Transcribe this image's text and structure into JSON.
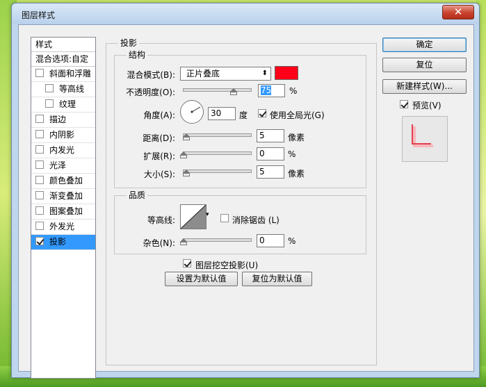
{
  "window": {
    "title": "图层样式",
    "close": "✕"
  },
  "style_list": {
    "header": "样式",
    "blend_options": "混合选项:自定",
    "items": [
      {
        "label": "斜面和浮雕",
        "checked": false,
        "sub": false
      },
      {
        "label": "等高线",
        "checked": false,
        "sub": true
      },
      {
        "label": "纹理",
        "checked": false,
        "sub": true
      },
      {
        "label": "描边",
        "checked": false,
        "sub": false
      },
      {
        "label": "内阴影",
        "checked": false,
        "sub": false
      },
      {
        "label": "内发光",
        "checked": false,
        "sub": false
      },
      {
        "label": "光泽",
        "checked": false,
        "sub": false
      },
      {
        "label": "颜色叠加",
        "checked": false,
        "sub": false
      },
      {
        "label": "渐变叠加",
        "checked": false,
        "sub": false
      },
      {
        "label": "图案叠加",
        "checked": false,
        "sub": false
      },
      {
        "label": "外发光",
        "checked": false,
        "sub": false
      },
      {
        "label": "投影",
        "checked": true,
        "sub": false,
        "selected": true
      }
    ]
  },
  "drop_shadow": {
    "section_title": "投影",
    "structure": {
      "title": "结构",
      "blend_mode_label": "混合模式(B):",
      "blend_mode_value": "正片叠底",
      "color": "#ff0018",
      "opacity_label": "不透明度(O):",
      "opacity_value": "75",
      "opacity_unit": "%",
      "opacity_level": 0.75,
      "angle_label": "角度(A):",
      "angle_value": "30",
      "angle_unit": "度",
      "global_light_label": "使用全局光(G)",
      "global_light_checked": true,
      "distance_label": "距离(D):",
      "distance_value": "5",
      "distance_unit": "像素",
      "spread_label": "扩展(R):",
      "spread_value": "0",
      "spread_unit": "%",
      "size_label": "大小(S):",
      "size_value": "5",
      "size_unit": "像素"
    },
    "quality": {
      "title": "品质",
      "contour_label": "等高线:",
      "antialias_label": "消除锯齿 (L)",
      "antialias_checked": false,
      "noise_label": "杂色(N):",
      "noise_value": "0",
      "noise_unit": "%"
    },
    "knockout_label": "图层挖空投影(U)",
    "knockout_checked": true,
    "make_default": "设置为默认值",
    "reset_default": "复位为默认值"
  },
  "buttons": {
    "ok": "确定",
    "reset": "复位",
    "new_style": "新建样式(W)...",
    "preview_label": "预览(V)",
    "preview_checked": true
  }
}
